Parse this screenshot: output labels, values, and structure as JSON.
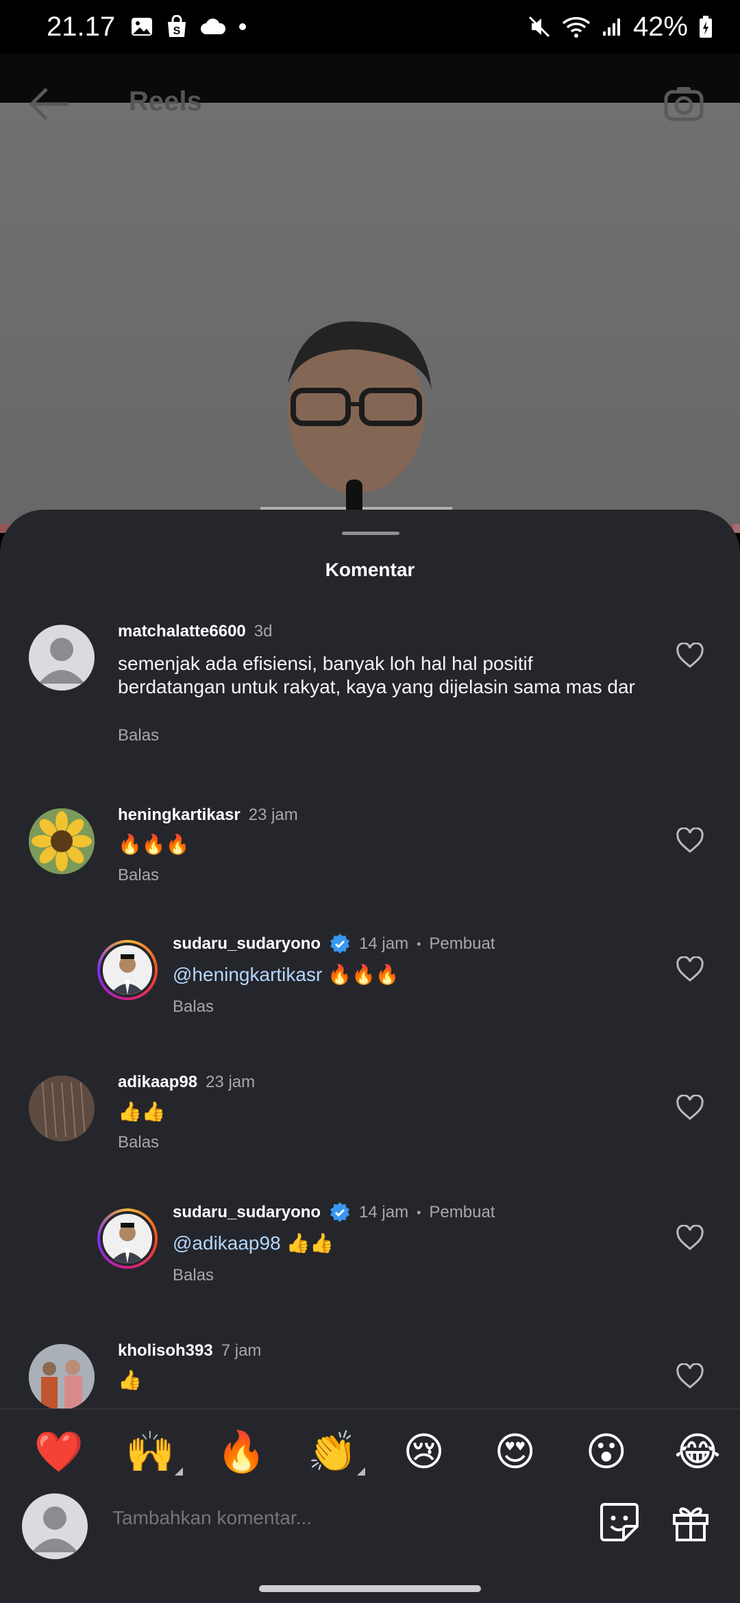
{
  "status_bar": {
    "time": "21.17",
    "battery": "42%"
  },
  "reel": {
    "title": "Reels"
  },
  "sheet": {
    "title": "Komentar"
  },
  "comments": [
    {
      "username": "matchalatte6600",
      "time": "3d",
      "text": "semenjak ada efisiensi, banyak loh hal hal positif berdatangan untuk rakyat, kaya yang dijelasin sama mas dar",
      "reply_label": "Balas"
    },
    {
      "username": "heningkartikasr",
      "time": "23 jam",
      "text": "🔥🔥🔥",
      "reply_label": "Balas"
    },
    {
      "username": "sudaru_sudaryono",
      "time": "14 jam",
      "author_badge": "Pembuat",
      "mention": "@heningkartikasr",
      "text": "🔥🔥🔥",
      "reply_label": "Balas"
    },
    {
      "username": "adikaap98",
      "time": "23 jam",
      "text": "👍👍",
      "reply_label": "Balas"
    },
    {
      "username": "sudaru_sudaryono",
      "time": "14 jam",
      "author_badge": "Pembuat",
      "mention": "@adikaap98",
      "text": "👍👍",
      "reply_label": "Balas"
    },
    {
      "username": "kholisoh393",
      "time": "7 jam",
      "text": "👍"
    }
  ],
  "emoji_bar": [
    "❤️",
    "🙌",
    "🔥",
    "👏",
    "😢",
    "😍",
    "😮",
    "😂"
  ],
  "composer": {
    "placeholder": "Tambahkan komentar..."
  },
  "colors": {
    "sheet_bg": "#25262b",
    "mention": "#b4d6ff",
    "verified": "#3897f0"
  }
}
